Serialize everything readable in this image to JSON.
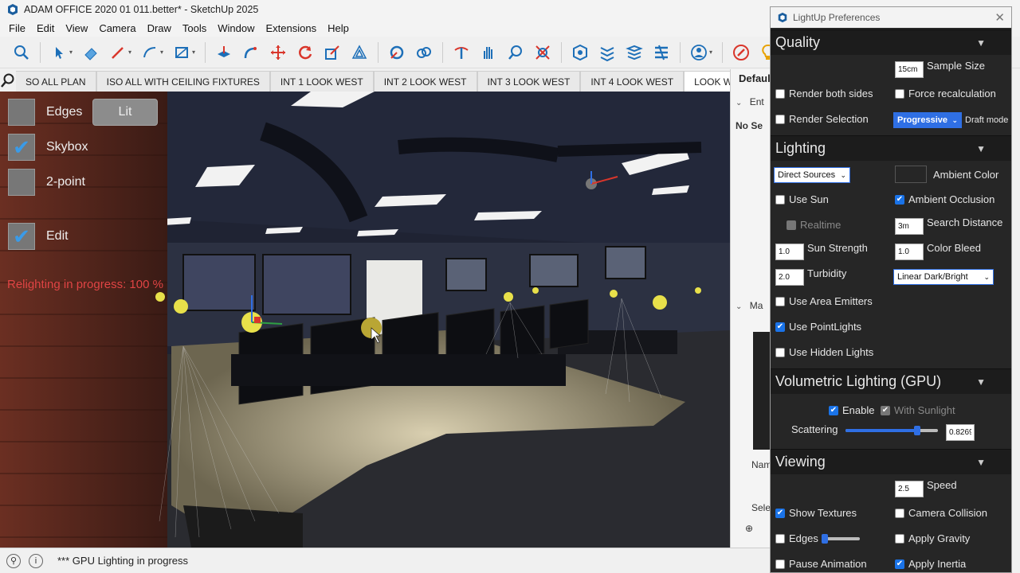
{
  "window": {
    "title": "ADAM OFFICE 2020 01 011.better* - SketchUp 2025"
  },
  "menu": [
    "File",
    "Edit",
    "View",
    "Camera",
    "Draw",
    "Tools",
    "Window",
    "Extensions",
    "Help"
  ],
  "toolbar": {
    "icons": [
      "search-icon",
      "select-icon",
      "eraser-icon",
      "pencil-icon",
      "arc-icon",
      "rectangle-icon",
      "push-pull-icon",
      "follow-me-icon",
      "move-icon",
      "rotate-icon",
      "scale-icon",
      "offset-icon",
      "tape-icon",
      "paint-icon",
      "split-icon",
      "hand-icon",
      "zoom-icon",
      "zoom-extents-icon",
      "component-icon",
      "layers-icon",
      "stack-icon",
      "settings-icon",
      "person-icon",
      "target-icon",
      "bulb-icon"
    ],
    "go_label": "GO"
  },
  "scene_tabs": [
    "SO ALL PLAN",
    "ISO ALL WITH CEILING FIXTURES",
    "INT 1 LOOK WEST",
    "INT 2 LOOK WEST",
    "INT 3 LOOK WEST",
    "INT 4 LOOK WEST",
    "LOOK WEST"
  ],
  "active_tab": "LOOK WEST",
  "overlay": {
    "edges_label": "Edges",
    "lit_label": "Lit",
    "skybox_label": "Skybox",
    "twopoint_label": "2-point",
    "edit_label": "Edit",
    "relight_status": "Relighting in progress: 100 %"
  },
  "dock": {
    "title": "Default",
    "entity": "Ent",
    "no_selection": "No Se",
    "materials": "Ma",
    "name": "Nam",
    "select": "Sele"
  },
  "prefs": {
    "title": "LightUp Preferences",
    "quality": {
      "heading": "Quality",
      "sample_size_value": "15cm",
      "sample_size_label": "Sample Size",
      "render_both_sides": "Render both sides",
      "force_recalc": "Force recalculation",
      "render_selection": "Render Selection",
      "mode_value": "Progressive",
      "draft_mode": "Draft mode"
    },
    "lighting": {
      "heading": "Lighting",
      "source_value": "Direct Sources",
      "ambient_color": "Ambient Color",
      "use_sun": "Use Sun",
      "ambient_occlusion": "Ambient Occlusion",
      "realtime": "Realtime",
      "search_distance_value": "3m",
      "search_distance": "Search Distance",
      "sun_strength_value": "1.0",
      "sun_strength": "Sun Strength",
      "color_bleed_value": "1.0",
      "color_bleed": "Color Bleed",
      "turbidity_value": "2.0",
      "turbidity": "Turbidity",
      "tone_value": "Linear Dark/Bright",
      "use_area_emitters": "Use Area Emitters",
      "use_pointlights": "Use PointLights",
      "use_hidden_lights": "Use Hidden Lights"
    },
    "volumetric": {
      "heading": "Volumetric Lighting (GPU)",
      "enable": "Enable",
      "with_sunlight": "With Sunlight",
      "scattering": "Scattering",
      "scattering_value": "0.8269"
    },
    "viewing": {
      "heading": "Viewing",
      "speed_value": "2.5",
      "speed": "Speed",
      "show_textures": "Show Textures",
      "camera_collision": "Camera Collision",
      "edges": "Edges",
      "apply_gravity": "Apply Gravity",
      "pause_animation": "Pause Animation",
      "apply_inertia": "Apply Inertia"
    }
  },
  "status": {
    "text": "*** GPU Lighting in progress"
  }
}
